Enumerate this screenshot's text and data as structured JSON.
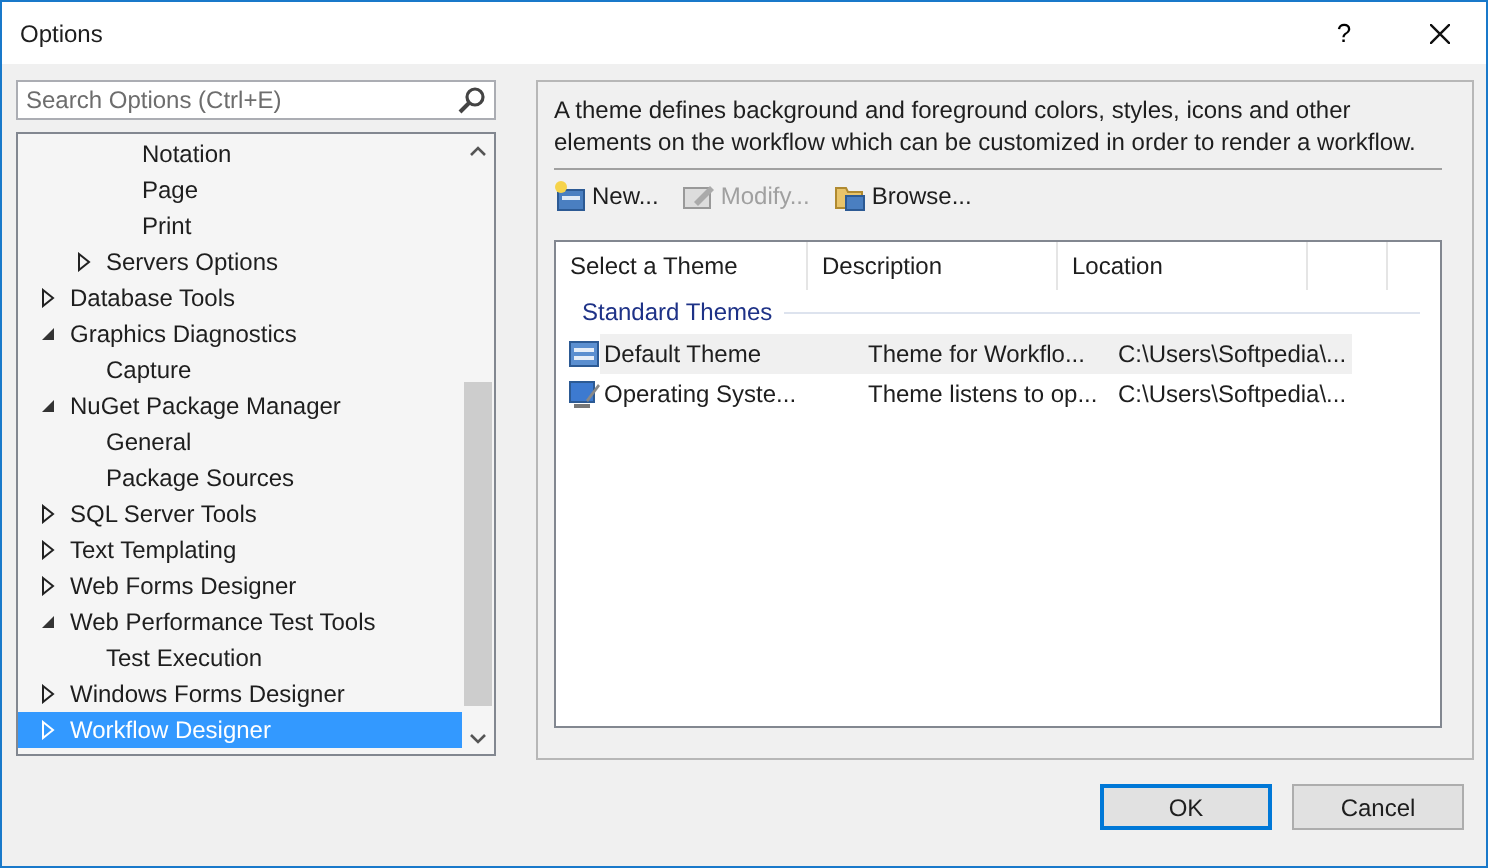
{
  "window": {
    "title": "Options",
    "help": "?"
  },
  "search": {
    "placeholder": "Search Options (Ctrl+E)"
  },
  "tree": {
    "items": [
      {
        "children": [
          {
            "children": [
              {
                "label": "Notation",
                "selected": false
              },
              {
                "label": "Page",
                "selected": false
              },
              {
                "label": "Print",
                "selected": false
              }
            ]
          },
          {
            "label": "Servers Options",
            "expanded": false,
            "selected": false
          }
        ]
      },
      {
        "label": "Database Tools",
        "expanded": false,
        "selected": false
      },
      {
        "label": "Graphics Diagnostics",
        "expanded": true,
        "selected": false,
        "children": [
          {
            "label": "Capture",
            "selected": false
          }
        ]
      },
      {
        "label": "NuGet Package Manager",
        "expanded": true,
        "selected": false,
        "children": [
          {
            "label": "General",
            "selected": false
          },
          {
            "label": "Package Sources",
            "selected": false
          }
        ]
      },
      {
        "label": "SQL Server Tools",
        "expanded": false,
        "selected": false
      },
      {
        "label": "Text Templating",
        "expanded": false,
        "selected": false
      },
      {
        "label": "Web Forms Designer",
        "expanded": false,
        "selected": false
      },
      {
        "label": "Web Performance Test Tools",
        "expanded": true,
        "selected": false,
        "children": [
          {
            "label": "Test Execution",
            "selected": false
          }
        ]
      },
      {
        "label": "Windows Forms Designer",
        "expanded": false,
        "selected": false
      },
      {
        "label": "Workflow Designer",
        "expanded": false,
        "selected": true
      }
    ]
  },
  "panel": {
    "description": "A theme defines background and foreground colors, styles, icons and other elements on the workflow which can be customized in order to render a workflow.",
    "toolbar": [
      {
        "label": "New...",
        "kind": "new",
        "disabled": false
      },
      {
        "label": "Modify...",
        "kind": "modify",
        "disabled": true
      },
      {
        "label": "Browse...",
        "kind": "browse",
        "disabled": false
      }
    ],
    "table": {
      "columns": [
        "Select a Theme",
        "Description",
        "Location"
      ],
      "group": "Standard Themes",
      "rows": [
        {
          "kind": "default",
          "cells": [
            "Default Theme",
            "Theme for Workflo...",
            "C:\\Users\\Softpedia\\..."
          ],
          "selected": true
        },
        {
          "kind": "system",
          "cells": [
            "Operating Syste...",
            "Theme listens to op...",
            "C:\\Users\\Softpedia\\..."
          ],
          "selected": false
        }
      ]
    }
  },
  "buttons": [
    {
      "label": "OK",
      "default": true
    },
    {
      "label": "Cancel",
      "default": false
    }
  ]
}
